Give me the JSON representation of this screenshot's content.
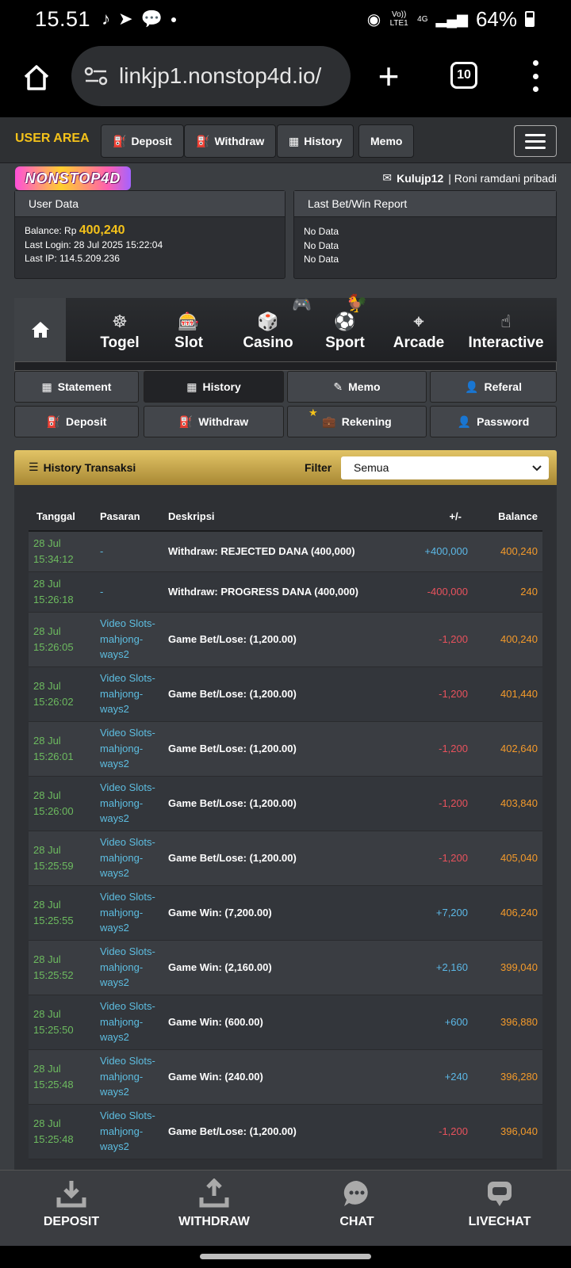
{
  "status": {
    "time": "15.51",
    "network": "Vo)) LTE1",
    "network_type": "4G",
    "battery": "64%"
  },
  "browser": {
    "url": "linkjp1.nonstop4d.io/",
    "tab_count": "10"
  },
  "topnav": {
    "user_area": "USER AREA",
    "buttons": [
      "Deposit",
      "Withdraw",
      "History",
      "Memo"
    ]
  },
  "logo": "NONSTOP4D",
  "user": {
    "username": "Kulujp12",
    "fullname": " | Roni ramdani pribadi"
  },
  "user_data": {
    "title": "User Data",
    "balance_label": "Balance: Rp ",
    "balance": "400,240",
    "last_login": "Last Login: 28 Jul 2025 15:22:04",
    "last_ip": "Last IP: 114.5.209.236"
  },
  "report": {
    "title": "Last Bet/Win Report",
    "lines": [
      "No Data",
      "No Data",
      "No Data"
    ]
  },
  "games": [
    "Togel",
    "Slot",
    "Casino",
    "Sport",
    "Arcade",
    "Interactive"
  ],
  "menu_row1": [
    "Statement",
    "History",
    "Memo",
    "Referal"
  ],
  "menu_row2": [
    "Deposit",
    "Withdraw",
    "Rekening",
    "Password"
  ],
  "history": {
    "title": "History Transaksi",
    "filter_label": "Filter",
    "filter_value": "Semua",
    "columns": [
      "Tanggal",
      "Pasaran",
      "Deskripsi",
      "+/-",
      "Balance"
    ],
    "rows": [
      {
        "date1": "28 Jul",
        "date2": "15:34:12",
        "pasaran": "-",
        "desc": "Withdraw: REJECTED DANA (400,000)",
        "amount": "+400,000",
        "balance": "400,240"
      },
      {
        "date1": "28 Jul",
        "date2": "15:26:18",
        "pasaran": "-",
        "desc": "Withdraw: PROGRESS DANA (400,000)",
        "amount": "-400,000",
        "balance": "240"
      },
      {
        "date1": "28 Jul",
        "date2": "15:26:05",
        "pasaran": "Video Slots-mahjong-ways2",
        "desc": "Game Bet/Lose: (1,200.00)",
        "amount": "-1,200",
        "balance": "400,240"
      },
      {
        "date1": "28 Jul",
        "date2": "15:26:02",
        "pasaran": "Video Slots-mahjong-ways2",
        "desc": "Game Bet/Lose: (1,200.00)",
        "amount": "-1,200",
        "balance": "401,440"
      },
      {
        "date1": "28 Jul",
        "date2": "15:26:01",
        "pasaran": "Video Slots-mahjong-ways2",
        "desc": "Game Bet/Lose: (1,200.00)",
        "amount": "-1,200",
        "balance": "402,640"
      },
      {
        "date1": "28 Jul",
        "date2": "15:26:00",
        "pasaran": "Video Slots-mahjong-ways2",
        "desc": "Game Bet/Lose: (1,200.00)",
        "amount": "-1,200",
        "balance": "403,840"
      },
      {
        "date1": "28 Jul",
        "date2": "15:25:59",
        "pasaran": "Video Slots-mahjong-ways2",
        "desc": "Game Bet/Lose: (1,200.00)",
        "amount": "-1,200",
        "balance": "405,040"
      },
      {
        "date1": "28 Jul",
        "date2": "15:25:55",
        "pasaran": "Video Slots-mahjong-ways2",
        "desc": "Game Win: (7,200.00)",
        "amount": "+7,200",
        "balance": "406,240"
      },
      {
        "date1": "28 Jul",
        "date2": "15:25:52",
        "pasaran": "Video Slots-mahjong-ways2",
        "desc": "Game Win: (2,160.00)",
        "amount": "+2,160",
        "balance": "399,040"
      },
      {
        "date1": "28 Jul",
        "date2": "15:25:50",
        "pasaran": "Video Slots-mahjong-ways2",
        "desc": "Game Win: (600.00)",
        "amount": "+600",
        "balance": "396,880"
      },
      {
        "date1": "28 Jul",
        "date2": "15:25:48",
        "pasaran": "Video Slots-mahjong-ways2",
        "desc": "Game Win: (240.00)",
        "amount": "+240",
        "balance": "396,280"
      },
      {
        "date1": "28 Jul",
        "date2": "15:25:48",
        "pasaran": "Video Slots-mahjong-ways2",
        "desc": "Game Bet/Lose: (1,200.00)",
        "amount": "-1,200",
        "balance": "396,040"
      }
    ]
  },
  "bottomnav": [
    "DEPOSIT",
    "WITHDRAW",
    "CHAT",
    "LIVECHAT"
  ],
  "colors": {
    "accent_yellow": "#f4c21a",
    "date_green": "#6dbb5f",
    "pasaran_blue": "#5dbde0",
    "positive": "#5cb8e6",
    "negative": "#e8525d",
    "balance_orange": "#f39a2b"
  }
}
